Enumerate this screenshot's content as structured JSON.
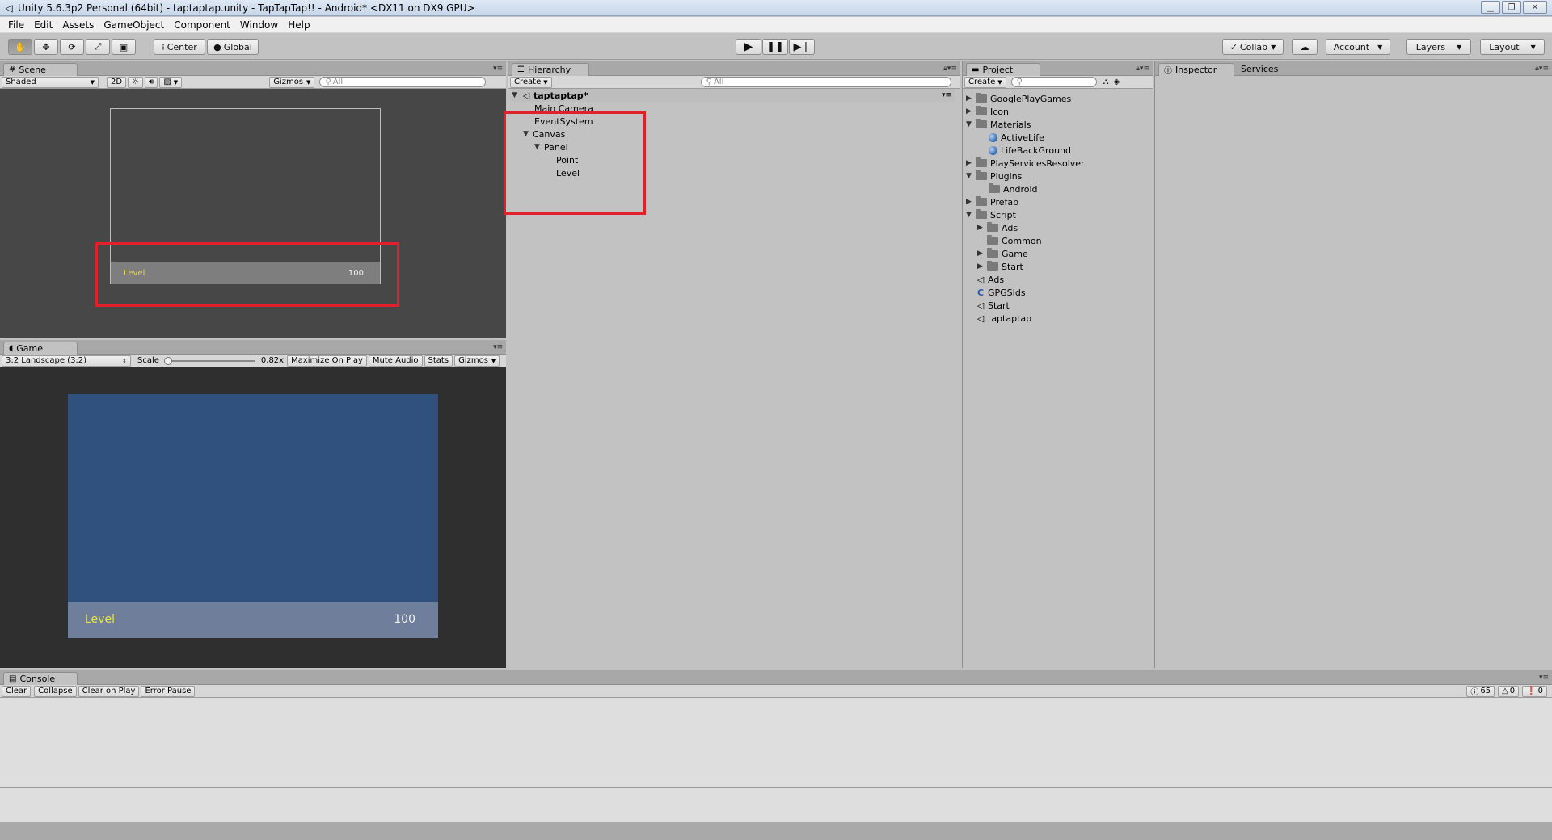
{
  "window": {
    "title": "Unity 5.6.3p2 Personal (64bit) - taptaptap.unity - TapTapTap!! - Android* <DX11 on DX9 GPU>"
  },
  "menu": [
    "File",
    "Edit",
    "Assets",
    "GameObject",
    "Component",
    "Window",
    "Help"
  ],
  "toolbar": {
    "pivot": "Center",
    "space": "Global",
    "collab": "Collab",
    "account": "Account",
    "layers": "Layers",
    "layout": "Layout"
  },
  "scene": {
    "tab": "Scene",
    "shading": "Shaded",
    "mode2d": "2D",
    "gizmos": "Gizmos",
    "search_placeholder": "All",
    "level_label": "Level",
    "level_value": "100"
  },
  "game": {
    "tab": "Game",
    "aspect": "3:2 Landscape (3:2)",
    "scale_label": "Scale",
    "scale_value": "0.82x",
    "maximize": "Maximize On Play",
    "mute": "Mute Audio",
    "stats": "Stats",
    "gizmos": "Gizmos",
    "level_label": "Level",
    "level_value": "100",
    "colors": {
      "panel": "#30507e",
      "bar": "#6f7e9a",
      "level": "#e6e44a"
    }
  },
  "hierarchy": {
    "tab": "Hierarchy",
    "create": "Create",
    "search_placeholder": "All",
    "scene_name": "taptaptap*",
    "items": [
      "Main Camera",
      "EventSystem",
      "Canvas",
      "Panel",
      "Point",
      "Level"
    ]
  },
  "project": {
    "tab": "Project",
    "create": "Create",
    "items": [
      "GooglePlayGames",
      "Icon",
      "Materials",
      "ActiveLife",
      "LifeBackGround",
      "PlayServicesResolver",
      "Plugins",
      "Android",
      "Prefab",
      "Script",
      "Ads",
      "Common",
      "Game",
      "Start",
      "Ads",
      "GPGSIds",
      "Start",
      "taptaptap"
    ]
  },
  "inspector": {
    "tab": "Inspector",
    "services": "Services"
  },
  "console": {
    "tab": "Console",
    "buttons": [
      "Clear",
      "Collapse",
      "Clear on Play",
      "Error Pause"
    ],
    "info_count": "65",
    "warn_count": "0",
    "error_count": "0"
  },
  "accent": "#e0202a"
}
